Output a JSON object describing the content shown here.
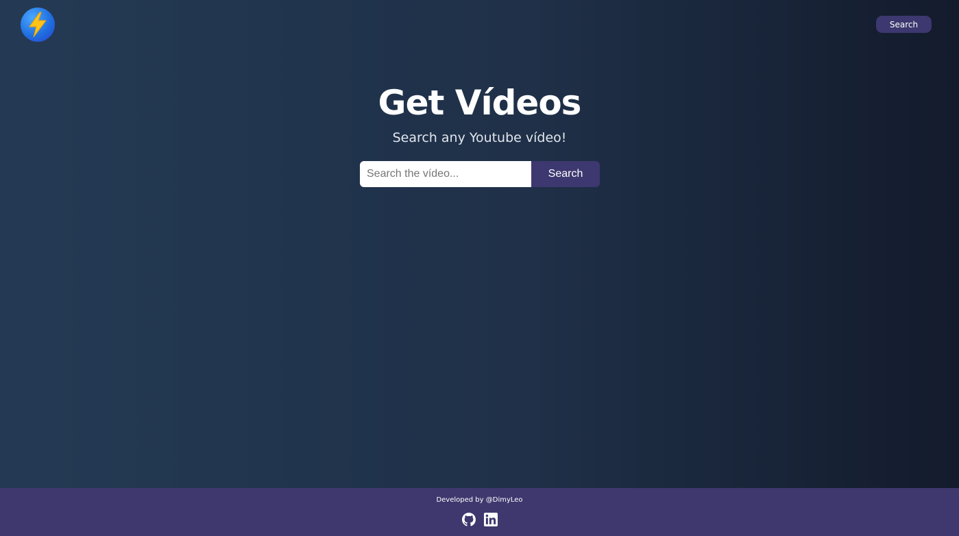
{
  "header": {
    "logo_icon": "lightning-bolt-icon",
    "nav_search_label": "Search"
  },
  "hero": {
    "title": "Get Vídeos",
    "subtitle": "Search any Youtube vídeo!"
  },
  "search": {
    "placeholder": "Search the vídeo...",
    "value": "",
    "button_label": "Search"
  },
  "footer": {
    "credit": "Developed by @DimyLeo",
    "icons": [
      "github-icon",
      "linkedin-icon"
    ]
  },
  "colors": {
    "accent": "#3d386f",
    "footer_bg": "#3e386e",
    "bg_left": "#243a54",
    "bg_right": "#131b2c"
  }
}
